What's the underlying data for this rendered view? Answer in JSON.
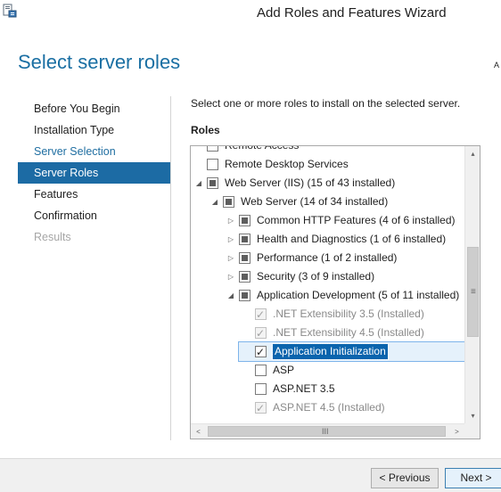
{
  "window": {
    "title": "Add Roles and Features Wizard"
  },
  "page": {
    "title": "Select server roles",
    "destination_fragment": "A"
  },
  "nav": {
    "items": [
      {
        "label": "Before You Begin",
        "state": "normal"
      },
      {
        "label": "Installation Type",
        "state": "normal"
      },
      {
        "label": "Server Selection",
        "state": "link"
      },
      {
        "label": "Server Roles",
        "state": "active"
      },
      {
        "label": "Features",
        "state": "normal"
      },
      {
        "label": "Confirmation",
        "state": "normal"
      },
      {
        "label": "Results",
        "state": "disabled"
      }
    ]
  },
  "content": {
    "instruction": "Select one or more roles to install on the selected server.",
    "roles_label": "Roles"
  },
  "roles": [
    {
      "label": "Remote Access",
      "level": 0,
      "expander": "none",
      "check": "none",
      "clipped": true
    },
    {
      "label": "Remote Desktop Services",
      "level": 0,
      "expander": "none",
      "check": "none"
    },
    {
      "label": "Web Server (IIS) (15 of 43 installed)",
      "level": 0,
      "expander": "expanded",
      "check": "partial"
    },
    {
      "label": "Web Server (14 of 34 installed)",
      "level": 1,
      "expander": "expanded",
      "check": "partial"
    },
    {
      "label": "Common HTTP Features (4 of 6 installed)",
      "level": 2,
      "expander": "collapsed",
      "check": "partial"
    },
    {
      "label": "Health and Diagnostics (1 of 6 installed)",
      "level": 2,
      "expander": "collapsed",
      "check": "partial"
    },
    {
      "label": "Performance (1 of 2 installed)",
      "level": 2,
      "expander": "collapsed",
      "check": "partial"
    },
    {
      "label": "Security (3 of 9 installed)",
      "level": 2,
      "expander": "collapsed",
      "check": "partial"
    },
    {
      "label": "Application Development (5 of 11 installed)",
      "level": 2,
      "expander": "expanded",
      "check": "partial"
    },
    {
      "label": ".NET Extensibility 3.5 (Installed)",
      "level": 3,
      "expander": "none",
      "check": "checked",
      "disabled": true
    },
    {
      "label": ".NET Extensibility 4.5 (Installed)",
      "level": 3,
      "expander": "none",
      "check": "checked",
      "disabled": true
    },
    {
      "label": "Application Initialization",
      "level": 3,
      "expander": "none",
      "check": "checked",
      "selected": true
    },
    {
      "label": "ASP",
      "level": 3,
      "expander": "none",
      "check": "none"
    },
    {
      "label": "ASP.NET 3.5",
      "level": 3,
      "expander": "none",
      "check": "none"
    },
    {
      "label": "ASP.NET 4.5 (Installed)",
      "level": 3,
      "expander": "none",
      "check": "checked",
      "disabled": true
    }
  ],
  "scrollbars": {
    "vertical": {
      "up_icon": "▴",
      "down_icon": "▾",
      "grip": "≡"
    },
    "horizontal": {
      "left_icon": "<",
      "right_icon": ">",
      "grip": "III"
    }
  },
  "footer": {
    "previous_label": "< Previous",
    "next_label": "Next >"
  },
  "glyphs": {
    "expanded": "◢",
    "collapsed": "▷"
  },
  "colors": {
    "accent": "#1c6ba4",
    "title": "#1a6fa3",
    "link": "#1f6ea1",
    "selection": "#0a64ad"
  }
}
